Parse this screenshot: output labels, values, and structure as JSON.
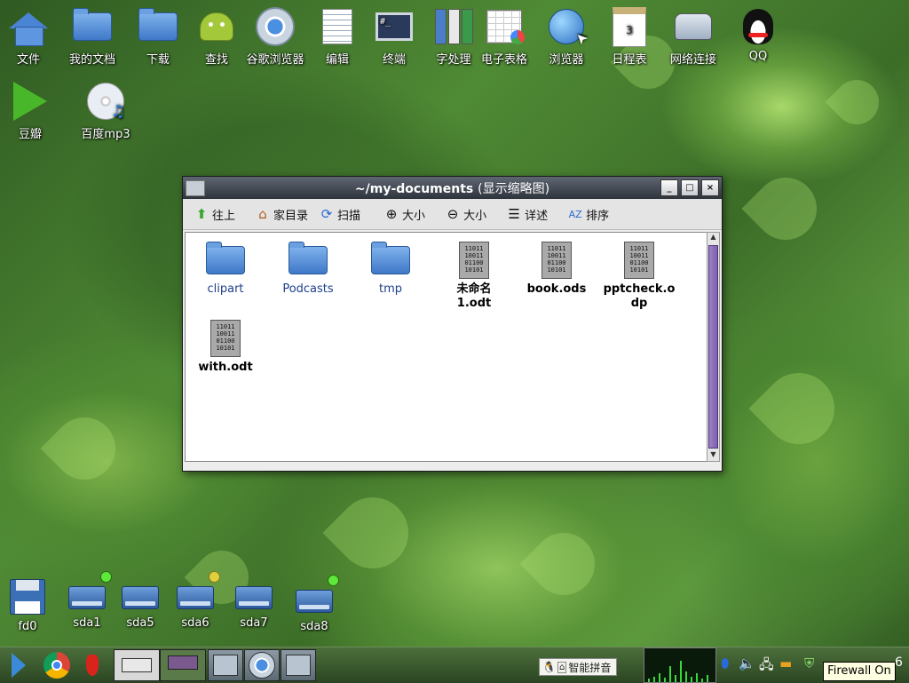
{
  "desktop": {
    "icons_row1": [
      "文件",
      "我的文档",
      "下载",
      "查找",
      "谷歌浏览器",
      "编辑",
      "终端",
      "字处理",
      "电子表格",
      "浏览器",
      "日程表",
      "网络连接",
      "QQ"
    ],
    "icons_row2": [
      "豆瓣",
      "百度mp3"
    ],
    "drives": [
      "fd0",
      "sda1",
      "sda5",
      "sda6",
      "sda7",
      "sda8"
    ],
    "drive_status": {
      "sda1": "#5ee83a",
      "sda6": "#e0d040",
      "sda8": "#5ee83a"
    }
  },
  "window": {
    "title_path": "~/my-documents",
    "title_mode": "(显示缩略图)",
    "controls": [
      "_",
      "□",
      "×"
    ],
    "toolbar": {
      "up": "往上",
      "home": "家目录",
      "scan": "扫描",
      "zoom_in": "大小",
      "zoom_out": "大小",
      "details": "详述",
      "sort": "排序"
    },
    "files": [
      {
        "name": "clipart",
        "type": "folder"
      },
      {
        "name": "Podcasts",
        "type": "folder"
      },
      {
        "name": "tmp",
        "type": "folder"
      },
      {
        "name": "未命名1.odt",
        "type": "document"
      },
      {
        "name": "book.ods",
        "type": "document"
      },
      {
        "name": "pptcheck.odp",
        "type": "document"
      },
      {
        "name": "with.odt",
        "type": "document"
      }
    ],
    "binary_glyph": "11011\n10011\n01100\n10101"
  },
  "taskbar": {
    "ime_label": "智能拼音",
    "clock_fragment": "6",
    "tooltip": "Firewall On"
  }
}
